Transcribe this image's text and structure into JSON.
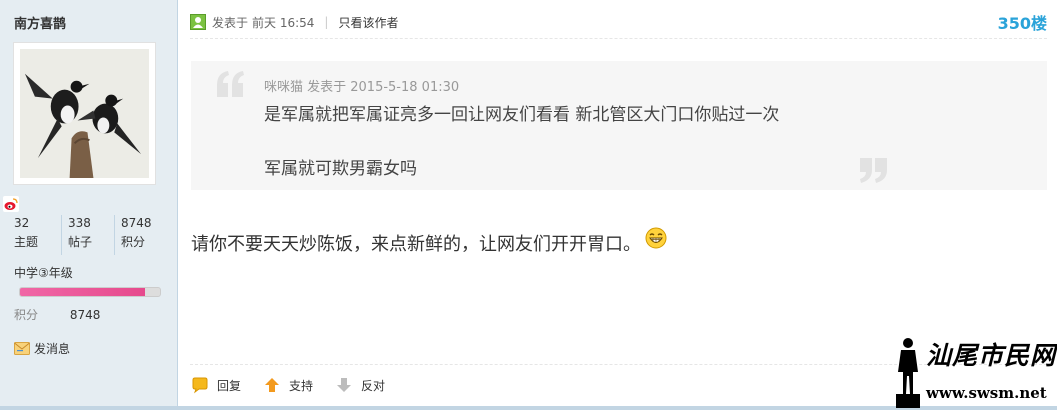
{
  "user": {
    "name": "南方喜鹊",
    "stats": [
      {
        "value": "32",
        "label": "主题"
      },
      {
        "value": "338",
        "label": "帖子"
      },
      {
        "value": "8748",
        "label": "积分"
      }
    ],
    "level": "中学③年级",
    "level_progress": 0.89,
    "points_label": "积分",
    "points_value": "8748",
    "send_message": "发消息"
  },
  "post": {
    "posted_prefix": "发表于",
    "posted_time": "前天 16:54",
    "author_only": "只看该作者",
    "floor_number": "350",
    "floor_suffix": "楼",
    "quote": {
      "meta": "咪咪猫 发表于 2015-5-18 01:30",
      "line1": "是军属就把军属证亮多一回让网友们看看   新北管区大门口你贴过一次",
      "line2": "军属就可欺男霸女吗"
    },
    "content": "请你不要天天炒陈饭，来点新鲜的，让网友们开开胃口。",
    "actions": {
      "reply": "回复",
      "support": "支持",
      "oppose": "反对"
    }
  },
  "watermark": {
    "title": "汕尾市民网",
    "url": "www.swsm.net"
  },
  "colors": {
    "sidebar_bg": "#e5edf2",
    "floor_blue": "#2aa3d9",
    "progress_pink": "#e64a8d"
  },
  "icons": [
    "weibo-icon",
    "online-icon",
    "envelope-icon",
    "grin-smiley-icon",
    "reply-bubble-icon",
    "support-arrow-up-icon",
    "oppose-arrow-down-icon"
  ]
}
